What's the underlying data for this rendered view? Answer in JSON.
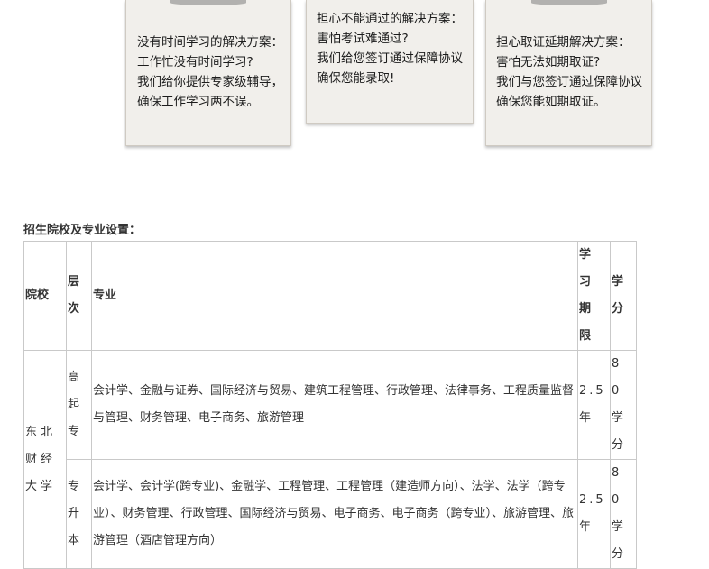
{
  "cards": [
    {
      "lines": [
        "没有时间学习的解决方案：",
        "工作忙没有时间学习?",
        "我们给你提供专家级辅导，",
        "确保工作学习两不误。"
      ]
    },
    {
      "lines": [
        "担心不能通过的解决方案：",
        "害怕考试难通过?",
        "我们给您签订通过保障协议",
        "确保您能录取!"
      ]
    },
    {
      "lines": [
        "担心取证延期解决方案：",
        "害怕无法如期取证?",
        "我们与您签订通过保障协议",
        "确保您能如期取证。"
      ]
    }
  ],
  "section_title": "招生院校及专业设置：",
  "table": {
    "headers": {
      "school": "院校",
      "level": "层次",
      "major": "专业",
      "duration": "学习期限",
      "credits": "学分"
    },
    "school": "东北财经大学",
    "rows": [
      {
        "level": "高起专",
        "majors": "会计学、金融与证券、国际经济与贸易、建筑工程管理、行政管理、法律事务、工程质量监督与管理、财务管理、电子商务、旅游管理",
        "duration": "2.5年",
        "credits": "80学分"
      },
      {
        "level": "专升本",
        "majors": "会计学、会计学(跨专业)、金融学、工程管理、工程管理（建造师方向）、法学、法学（跨专业）、财务管理、行政管理、国际经济与贸易、电子商务、电子商务（跨专业）、旅游管理、旅游管理（酒店管理方向）",
        "duration": "2.5年",
        "credits": "80学分"
      }
    ]
  }
}
